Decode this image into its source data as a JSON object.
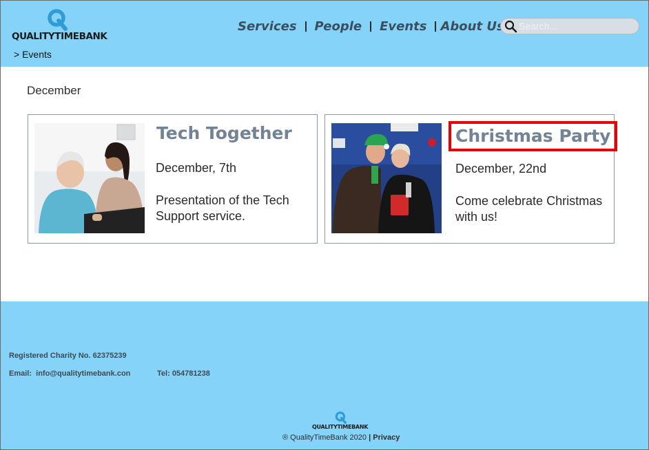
{
  "brand": {
    "name": "QUALITYTIMEBANK",
    "accent": "#85d3f8",
    "logo_color": "#2f9bd7"
  },
  "breadcrumb": "> Events",
  "nav": {
    "items": [
      {
        "label": "Services"
      },
      {
        "label": "People"
      },
      {
        "label": "Events"
      },
      {
        "label": "About Us"
      }
    ]
  },
  "search": {
    "placeholder": "Search..."
  },
  "main": {
    "month": "December",
    "events": [
      {
        "title": "Tech Together",
        "date": "December, 7th",
        "description": "Presentation of the Tech Support service.",
        "image": "two-women-at-laptop-photo"
      },
      {
        "title": "Christmas Party",
        "date": "December, 22nd",
        "description": "Come celebrate Christmas with us!",
        "image": "christmas-party-couple-photo",
        "highlight_color": "#ea0000"
      }
    ]
  },
  "footer": {
    "charity": "Registered Charity No. 62375239",
    "email_label": "Email:",
    "email": "info@qualitytimebank.con",
    "tel_label": "Tel:",
    "tel": "054781238",
    "logo_text": "QUALITYTIMEBANK",
    "copyright": "® QualityTimeBank 2020",
    "separator": "|",
    "privacy": "Privacy"
  }
}
